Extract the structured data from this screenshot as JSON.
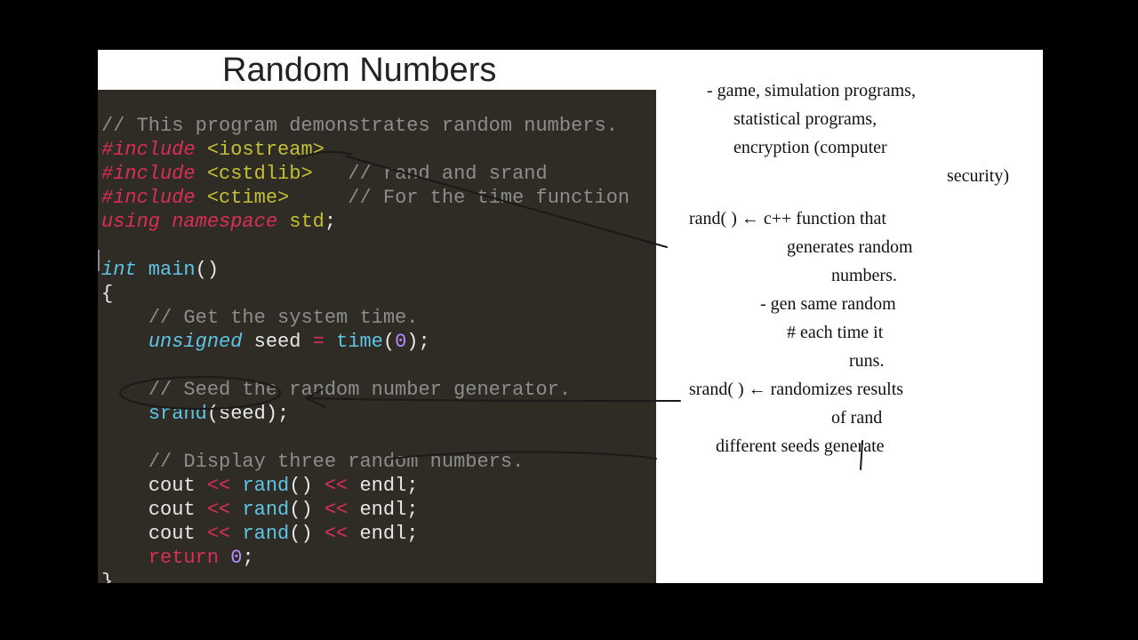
{
  "title": "Random Numbers",
  "code": {
    "l1": "// This program demonstrates random numbers.",
    "l2": {
      "pre": "#include",
      "hdr": " <iostream>"
    },
    "l3": {
      "pre": "#include",
      "hdr": " <cstdlib>",
      "cm": "   // rand and srand"
    },
    "l4": {
      "pre": "#include",
      "hdr": " <ctime>",
      "cm": "     // For the time function"
    },
    "l5": {
      "kw1": "using",
      "kw2": " namespace",
      "nm": " std",
      "sc": ";"
    },
    "l7": {
      "ty": "int",
      "fn": " main",
      "rest": "()"
    },
    "l8": "{",
    "l9": {
      "indent": "    ",
      "cm": "// Get the system time."
    },
    "l10": {
      "indent": "    ",
      "ty": "unsigned",
      "sp": " ",
      "id": "seed ",
      "op": "=",
      "sp2": " ",
      "fn": "time",
      "par": "(",
      "num": "0",
      "par2": ")",
      "sc": ";"
    },
    "l12": {
      "indent": "    ",
      "cm": "// Seed the random number generator."
    },
    "l13": {
      "indent": "    ",
      "fn": "srand",
      "rest": "(seed);"
    },
    "l15": {
      "indent": "    ",
      "cm": "// Display three random numbers."
    },
    "l16": {
      "indent": "    ",
      "id": "cout ",
      "op": "<<",
      "sp": " ",
      "fn": "rand",
      "par": "() ",
      "op2": "<<",
      "sp2": " ",
      "id2": "endl",
      "sc": ";"
    },
    "l17": {
      "indent": "    ",
      "id": "cout ",
      "op": "<<",
      "sp": " ",
      "fn": "rand",
      "par": "() ",
      "op2": "<<",
      "sp2": " ",
      "id2": "endl",
      "sc": ";"
    },
    "l18": {
      "indent": "    ",
      "id": "cout ",
      "op": "<<",
      "sp": " ",
      "fn": "rand",
      "par": "() ",
      "op2": "<<",
      "sp2": " ",
      "id2": "endl",
      "sc": ";"
    },
    "l19": {
      "indent": "    ",
      "kw": "return",
      "sp": " ",
      "num": "0",
      "sc": ";"
    },
    "l20": "}"
  },
  "notes": {
    "n1": "- game, simulation programs,",
    "n2": "statistical programs,",
    "n3": "encryption (computer",
    "n4": "security)",
    "n5": "rand( ) ←  c++ function that",
    "n6": "generates random",
    "n7": "numbers.",
    "n8": "- gen same random",
    "n9": "# each time it",
    "n10": "runs.",
    "n11": "srand( ) ← randomizes results",
    "n12": "of rand",
    "n13": "different seeds generate"
  }
}
